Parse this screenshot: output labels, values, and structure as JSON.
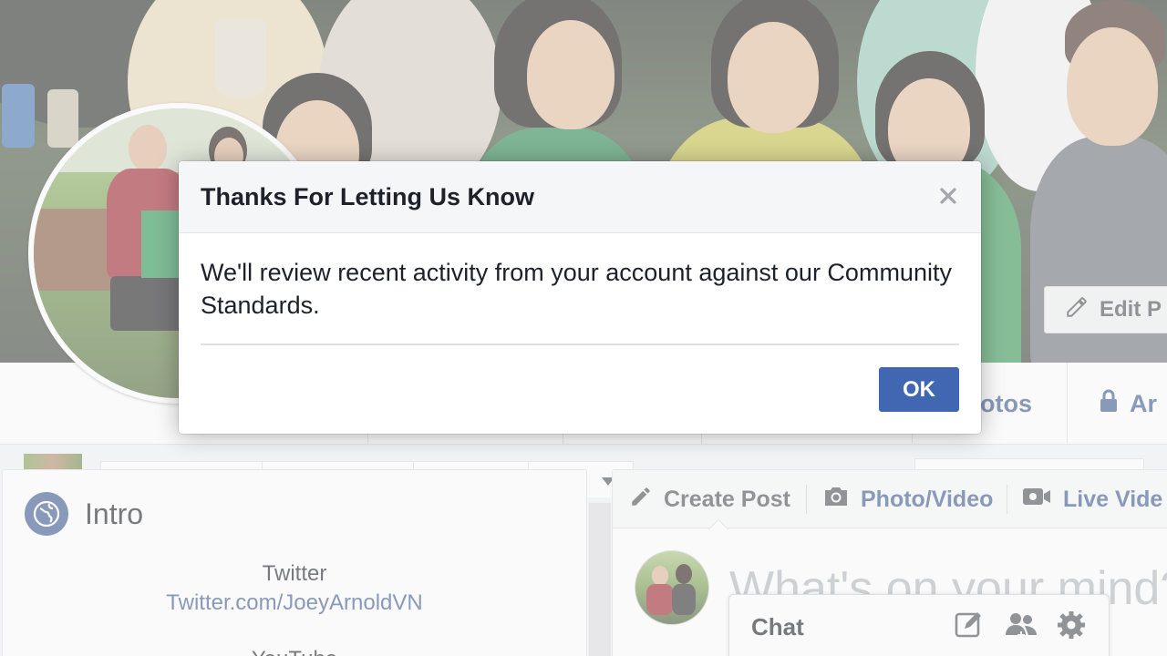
{
  "cover": {
    "edit_button_label": "Edit P"
  },
  "profile_nav": {
    "photos_label": "otos",
    "archive_label": "Ar"
  },
  "intro": {
    "title": "Intro",
    "twitter_label": "Twitter",
    "twitter_link": "Twitter.com/JoeyArnoldVN",
    "next_label": "YouTube"
  },
  "composer": {
    "create_post_label": "Create Post",
    "photo_video_label": "Photo/Video",
    "live_video_label": "Live Vide",
    "placeholder": "What's on your mind?"
  },
  "chat": {
    "title": "Chat"
  },
  "dialog": {
    "title": "Thanks For Letting Us Know",
    "body": "We'll review recent activity from your account against our Community Standards.",
    "ok_label": "OK",
    "close_symbol": "×"
  },
  "colors": {
    "link_blue": "#365899",
    "button_blue": "#4267b2",
    "globe_blue": "#385898",
    "text_dark": "#1d2129",
    "muted_icon": "#4b4f56"
  },
  "icons": {
    "edit": "pencil-icon",
    "photos": "photo-icon",
    "archive": "lock-icon",
    "intro": "globe-icon",
    "create_post": "pencil-icon",
    "photo_video": "camera-icon",
    "live_video": "video-camera-icon",
    "chat_compose": "compose-icon",
    "chat_people": "people-icon",
    "chat_settings": "gear-icon",
    "close": "close-icon"
  }
}
